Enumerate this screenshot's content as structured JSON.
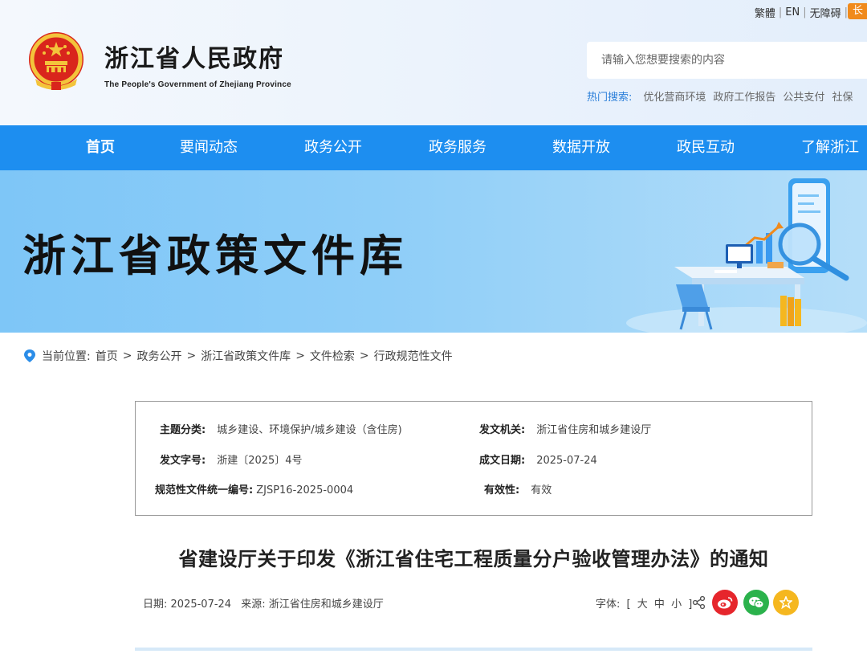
{
  "header": {
    "title": "浙江省人民政府",
    "subtitle": "The People's Government of Zhejiang Province",
    "top_links": [
      "繁體",
      "EN",
      "无障碍"
    ],
    "elder_label": "长",
    "search_placeholder": "请输入您想要搜索的内容",
    "hot_label": "热门搜索:",
    "hot_items": [
      "优化营商环境",
      "政府工作报告",
      "公共支付",
      "社保"
    ]
  },
  "nav": {
    "items": [
      "首页",
      "要闻动态",
      "政务公开",
      "政务服务",
      "数据开放",
      "政民互动",
      "了解浙江"
    ]
  },
  "banner": {
    "title": "浙江省政策文件库"
  },
  "breadcrumb": {
    "prefix": "当前位置:",
    "items": [
      "首页",
      "政务公开",
      "浙江省政策文件库",
      "文件检索",
      "行政规范性文件"
    ],
    "separator": ">"
  },
  "info": {
    "topic_label": "主题分类:",
    "topic_value": "城乡建设、环境保护/城乡建设（含住房)",
    "issuer_label": "发文机关:",
    "issuer_value": "浙江省住房和城乡建设厅",
    "docno_label": "发文字号:",
    "docno_value": "浙建〔2025〕4号",
    "date_label": "成文日期:",
    "date_value": "2025-07-24",
    "code_label": "规范性文件统一编号:",
    "code_value": "ZJSP16-2025-0004",
    "validity_label": "有效性:",
    "validity_value": "有效"
  },
  "article": {
    "title": "省建设厅关于印发《浙江省住宅工程质量分户验收管理办法》的通知",
    "date_label": "日期:",
    "date_value": "2025-07-24",
    "source_label": "来源:",
    "source_value": "浙江省住房和城乡建设厅",
    "font_label": "字体:",
    "font_open": "[",
    "font_large": "大",
    "font_medium": "中",
    "font_small": "小",
    "font_close": "]"
  },
  "colors": {
    "nav_blue": "#1d8ef0",
    "weibo_red": "#e6262c",
    "wechat_green": "#2bb24c",
    "favorite_yellow": "#f5b71f",
    "elder_orange": "#f08a1c"
  }
}
